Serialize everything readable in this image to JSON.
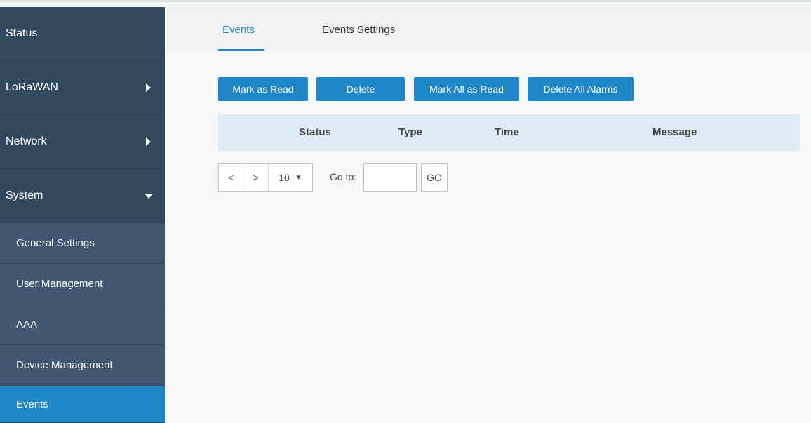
{
  "sidebar": {
    "items": [
      {
        "label": "Status"
      },
      {
        "label": "LoRaWAN"
      },
      {
        "label": "Network"
      },
      {
        "label": "System"
      }
    ],
    "system_sub": [
      {
        "label": "General Settings"
      },
      {
        "label": "User Management"
      },
      {
        "label": "AAA"
      },
      {
        "label": "Device Management"
      },
      {
        "label": "Events"
      }
    ]
  },
  "tabs": [
    {
      "label": "Events",
      "active": true
    },
    {
      "label": "Events Settings",
      "active": false
    }
  ],
  "toolbar": {
    "mark_read": "Mark as Read",
    "delete": "Delete",
    "mark_all_read": "Mark All as Read",
    "delete_all_alarms": "Delete All Alarms"
  },
  "table": {
    "columns": [
      "Status",
      "Type",
      "Time",
      "Message"
    ],
    "rows": []
  },
  "pagination": {
    "prev": "<",
    "next": ">",
    "page_size": "10",
    "goto_label": "Go to:",
    "goto_value": "",
    "go_label": "GO"
  },
  "colors": {
    "sidebar_bg": "#33495e",
    "submenu_bg": "#3f5770",
    "accent": "#1f86c7",
    "table_header_bg": "#ddebf5"
  },
  "icons": {
    "expand": "caret-right-icon",
    "collapse": "caret-down-icon",
    "dropdown": "caret-down-icon"
  }
}
